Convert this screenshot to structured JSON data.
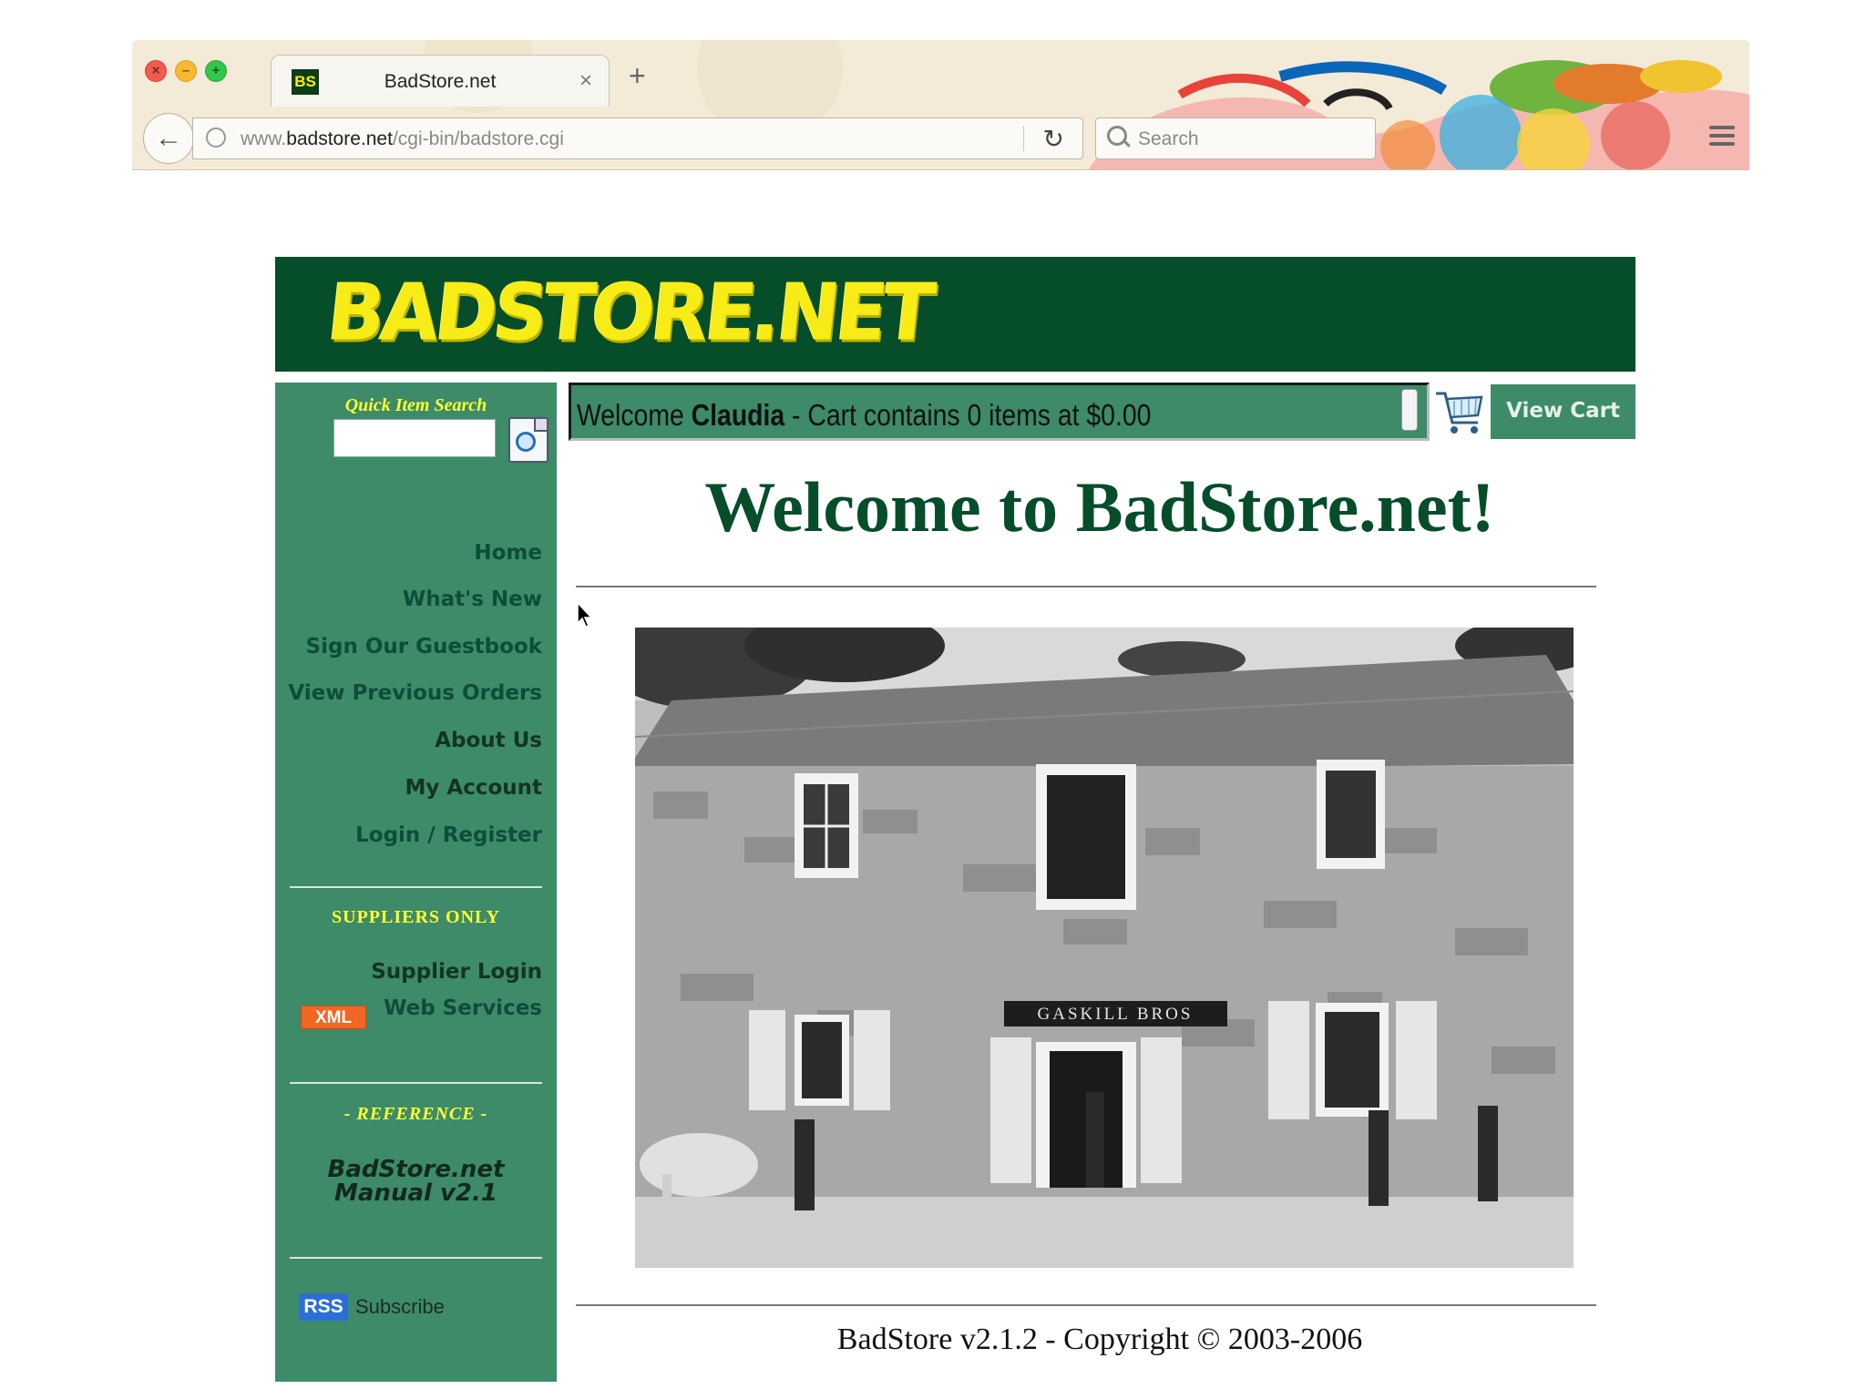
{
  "browser": {
    "tab_title": "BadStore.net",
    "tab_favicon_text": "BS",
    "tab_close": "×",
    "new_tab": "+",
    "url_prefix": "www.",
    "url_domain": "badstore.net",
    "url_path": "/cgi-bin/badstore.cgi",
    "search_placeholder": "Search"
  },
  "site": {
    "logo_text": "BADSTORE.NET",
    "banner_color": "#064d2a",
    "sidebar_color": "#3d8b68",
    "accent_yellow": "#ffff33"
  },
  "sidebar": {
    "quick_search_label": "Quick Item Search",
    "nav": [
      {
        "label": "Home"
      },
      {
        "label": "What's New"
      },
      {
        "label": "Sign Our Guestbook"
      },
      {
        "label": "View Previous Orders"
      },
      {
        "label": "About Us"
      },
      {
        "label": "My Account"
      },
      {
        "label": "Login / Register"
      }
    ],
    "suppliers_heading": "SUPPLIERS ONLY",
    "supplier_login": "Supplier Login",
    "xml_badge": "XML",
    "web_services": "Web Services",
    "reference_heading": "- REFERENCE -",
    "manual_line1": "BadStore.net",
    "manual_line2": "Manual v2.1",
    "rss_badge": "RSS",
    "subscribe": "Subscribe"
  },
  "cart_bar": {
    "welcome_prefix": "Welcome ",
    "user_name": "Claudia",
    "cart_summary": " - Cart contains 0 items at $0.00",
    "view_cart": "View Cart"
  },
  "main": {
    "title": "Welcome to BadStore.net!",
    "photo_sign": "GASKILL BROS",
    "copyright": "BadStore v2.1.2 - Copyright © 2003-2006"
  }
}
